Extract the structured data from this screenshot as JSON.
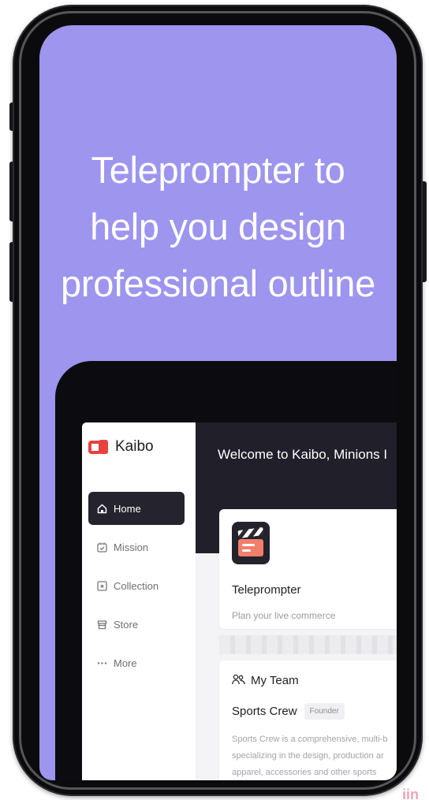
{
  "promo": {
    "headline": [
      "Teleprompter to",
      "help you design",
      "professional outline"
    ]
  },
  "app": {
    "logo_text": "Kaibo",
    "nav": [
      {
        "label": "Home",
        "icon": "home-icon",
        "active": true
      },
      {
        "label": "Mission",
        "icon": "calendar-check-icon",
        "active": false
      },
      {
        "label": "Collection",
        "icon": "collection-icon",
        "active": false
      },
      {
        "label": "Store",
        "icon": "store-icon",
        "active": false
      },
      {
        "label": "More",
        "icon": "more-dots-icon",
        "active": false
      }
    ],
    "welcome": "Welcome to Kaibo, Minions I",
    "teleprompter_card": {
      "title": "Teleprompter",
      "subtitle": "Plan your live commerce"
    },
    "team_card": {
      "heading": "My Team",
      "team_name": "Sports Crew",
      "role_badge": "Founder",
      "description_lines": [
        "Sports Crew is a comprehensive, multi-b",
        "specializing in the design, production ar",
        "apparel, accessories and other sports"
      ]
    }
  },
  "watermark": "iin",
  "colors": {
    "screen_background": "#9d95ee",
    "active_nav": "#25242e",
    "banner": "#211f2a",
    "logo_accent": "#e9413d"
  }
}
